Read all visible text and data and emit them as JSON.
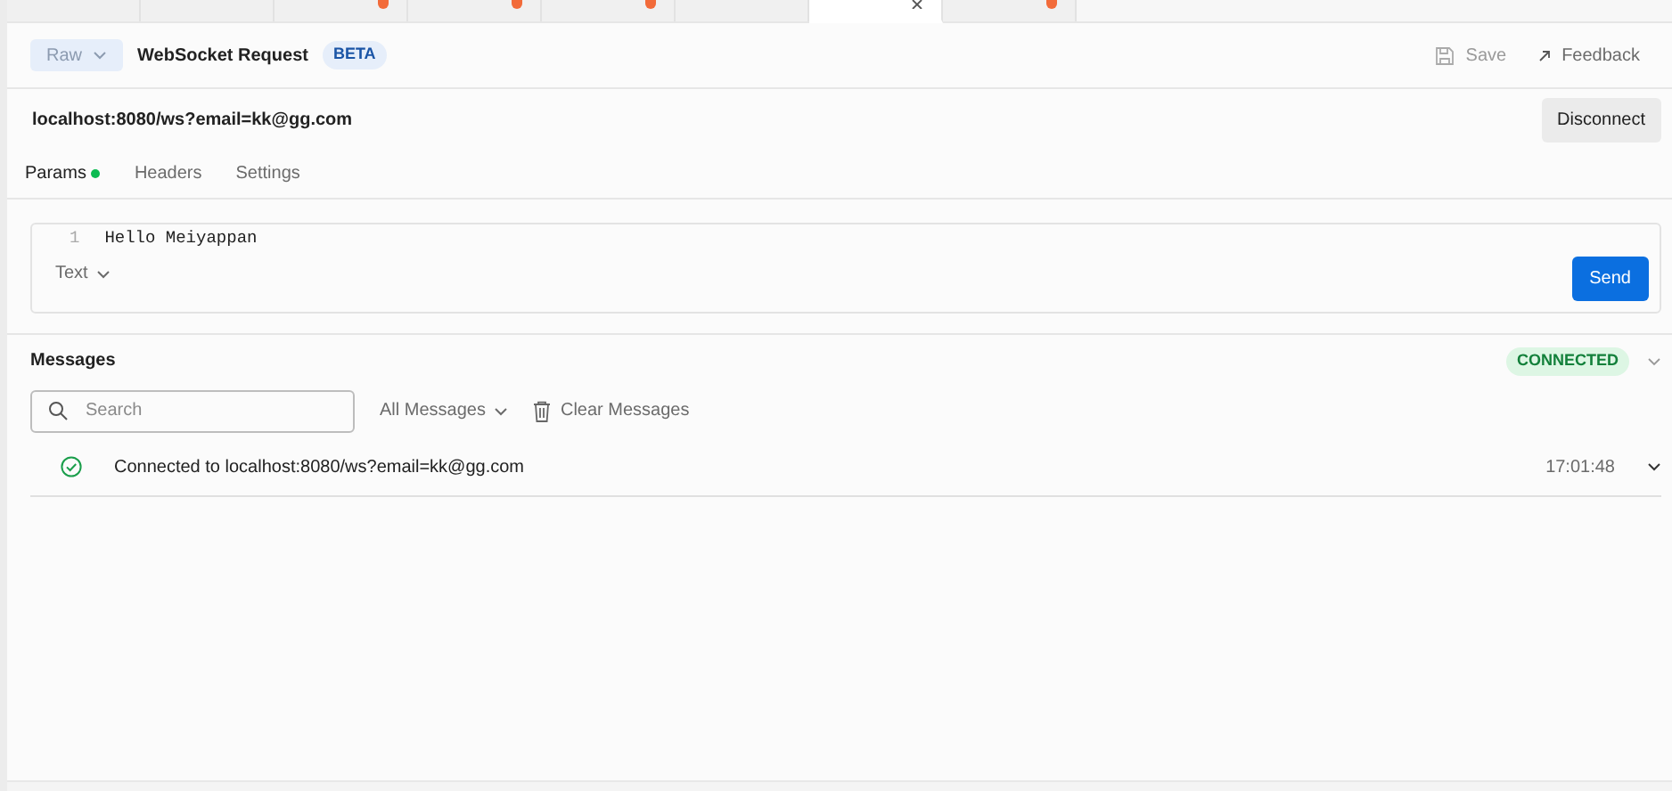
{
  "tab_strip": {
    "tabs": [
      {
        "selected": false,
        "unsaved": false
      },
      {
        "selected": false,
        "unsaved": false
      },
      {
        "selected": false,
        "unsaved": true
      },
      {
        "selected": false,
        "unsaved": true
      },
      {
        "selected": false,
        "unsaved": true
      },
      {
        "selected": false,
        "unsaved": false
      },
      {
        "selected": true,
        "unsaved": false
      },
      {
        "selected": false,
        "unsaved": true
      }
    ]
  },
  "header": {
    "mode": "Raw",
    "title": "WebSocket Request",
    "badge": "BETA",
    "save": "Save",
    "feedback": "Feedback"
  },
  "url": {
    "value": "localhost:8080/ws?email=kk@gg.com",
    "action": "Disconnect"
  },
  "request_tabs": [
    {
      "label": "Params",
      "selected": true,
      "indicator": true
    },
    {
      "label": "Headers",
      "selected": false,
      "indicator": false
    },
    {
      "label": "Settings",
      "selected": false,
      "indicator": false
    }
  ],
  "editor": {
    "lines": [
      {
        "number": "1",
        "text": "Hello Meiyappan"
      }
    ],
    "format": "Text",
    "send": "Send"
  },
  "messages": {
    "title": "Messages",
    "status": "CONNECTED",
    "search_placeholder": "Search",
    "filter": "All Messages",
    "clear": "Clear Messages",
    "items": [
      {
        "text": "Connected to localhost:8080/ws?email=kk@gg.com",
        "time": "17:01:48"
      }
    ]
  }
}
